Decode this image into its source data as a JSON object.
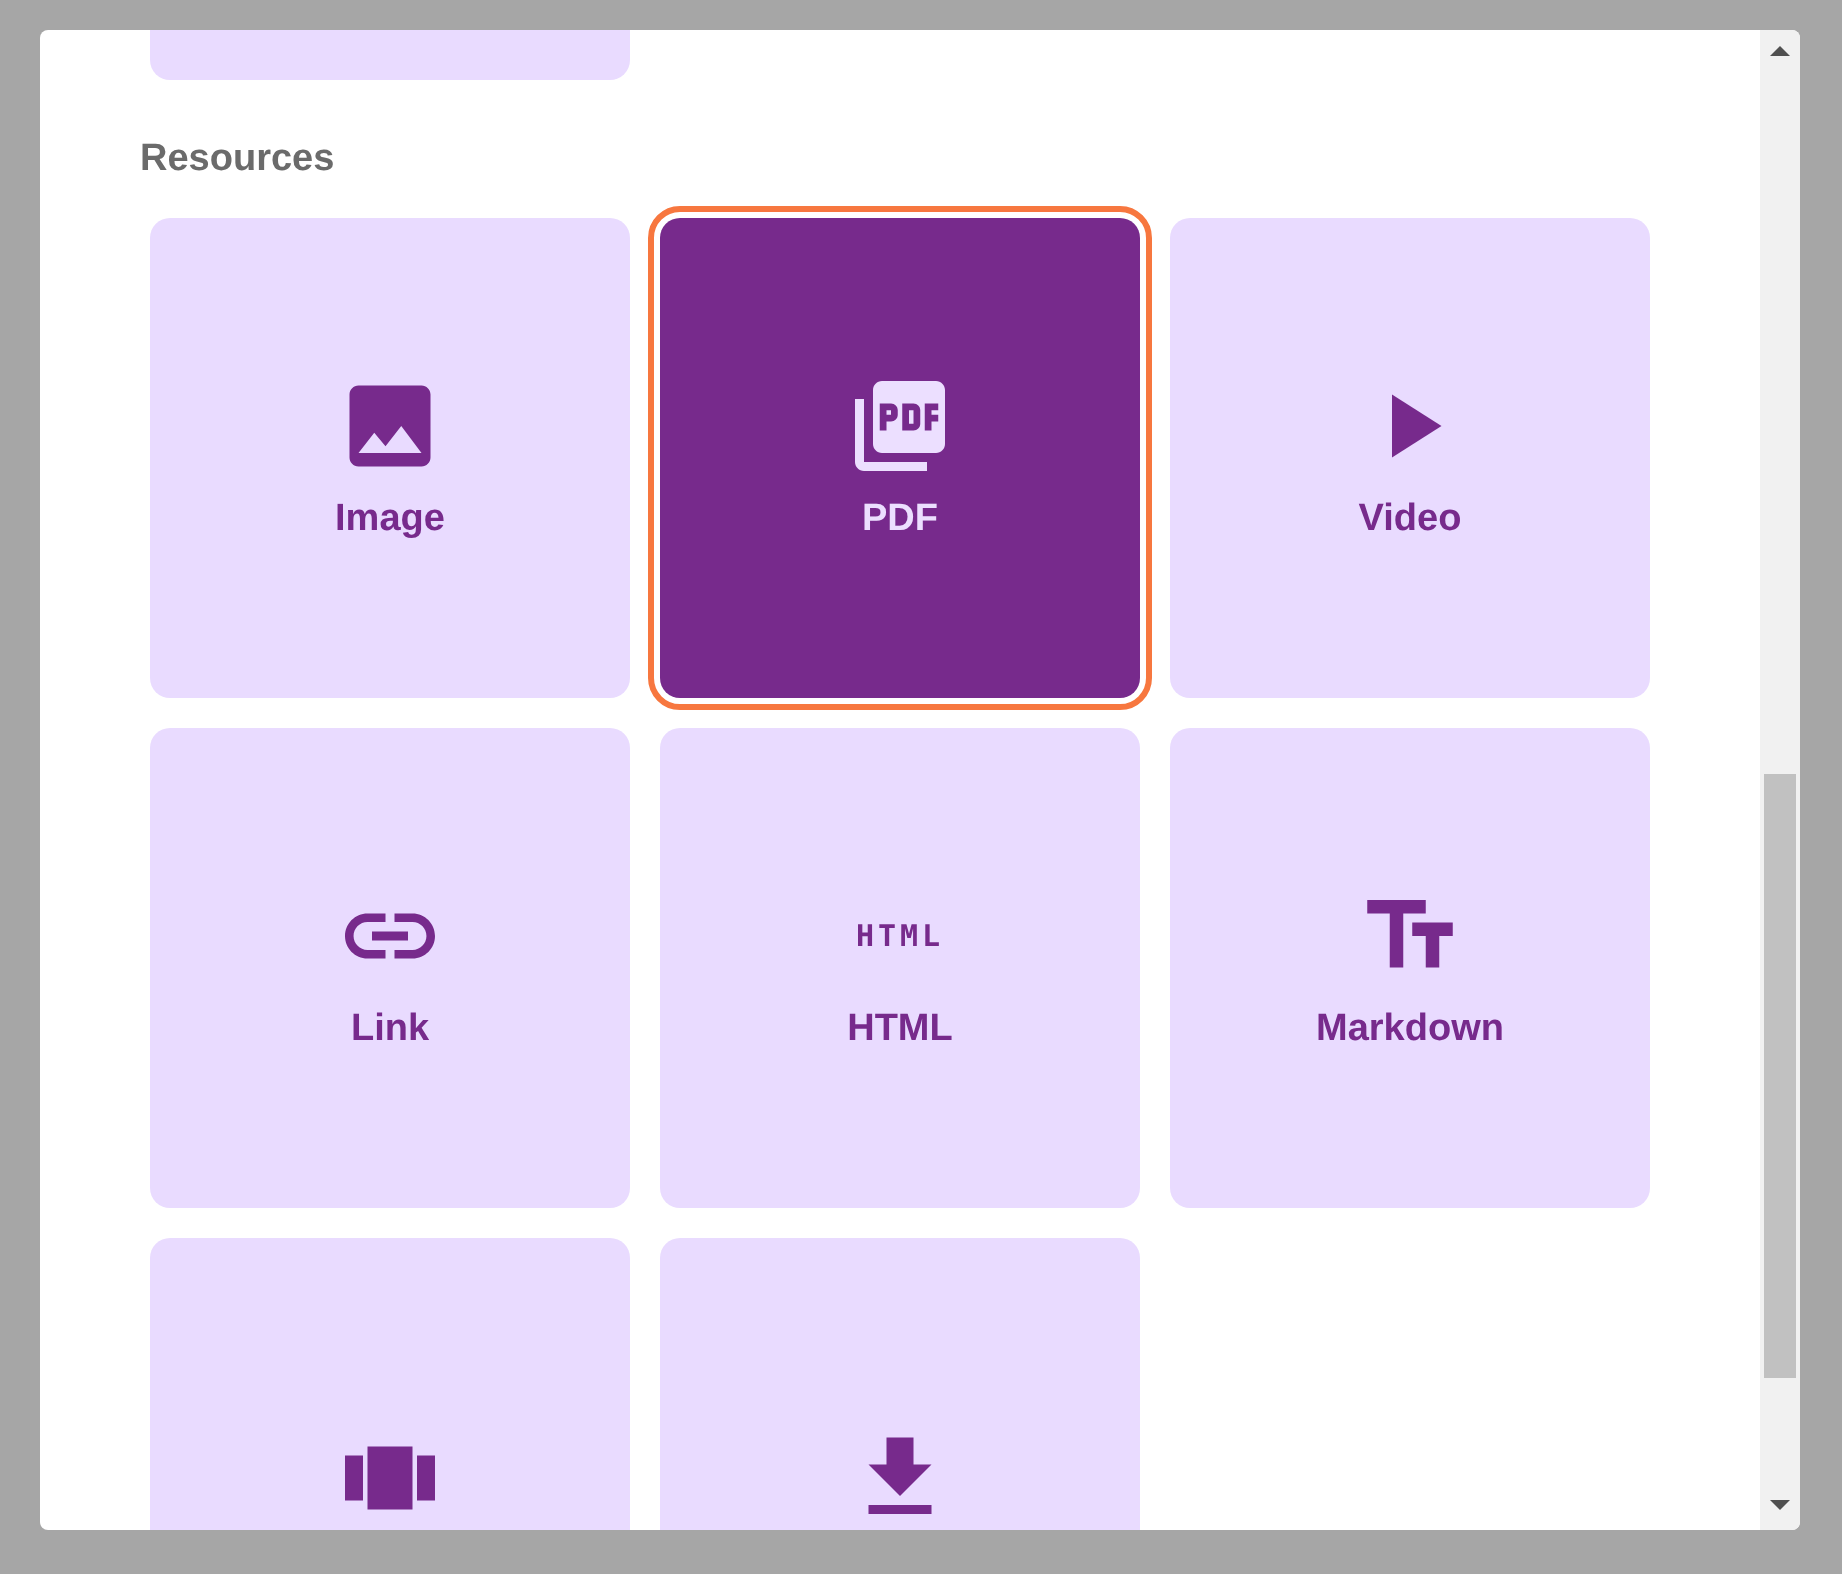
{
  "section": {
    "title": "Resources"
  },
  "tiles": [
    {
      "kind": "image",
      "label": "Image",
      "selected": false
    },
    {
      "kind": "pdf",
      "label": "PDF",
      "selected": true
    },
    {
      "kind": "video",
      "label": "Video",
      "selected": false
    },
    {
      "kind": "link",
      "label": "Link",
      "selected": false
    },
    {
      "kind": "html",
      "icon_text": "HTML",
      "label": "HTML",
      "selected": false
    },
    {
      "kind": "markdown",
      "label": "Markdown",
      "selected": false
    },
    {
      "kind": "carousel",
      "selected": false
    },
    {
      "kind": "download",
      "selected": false
    }
  ]
}
